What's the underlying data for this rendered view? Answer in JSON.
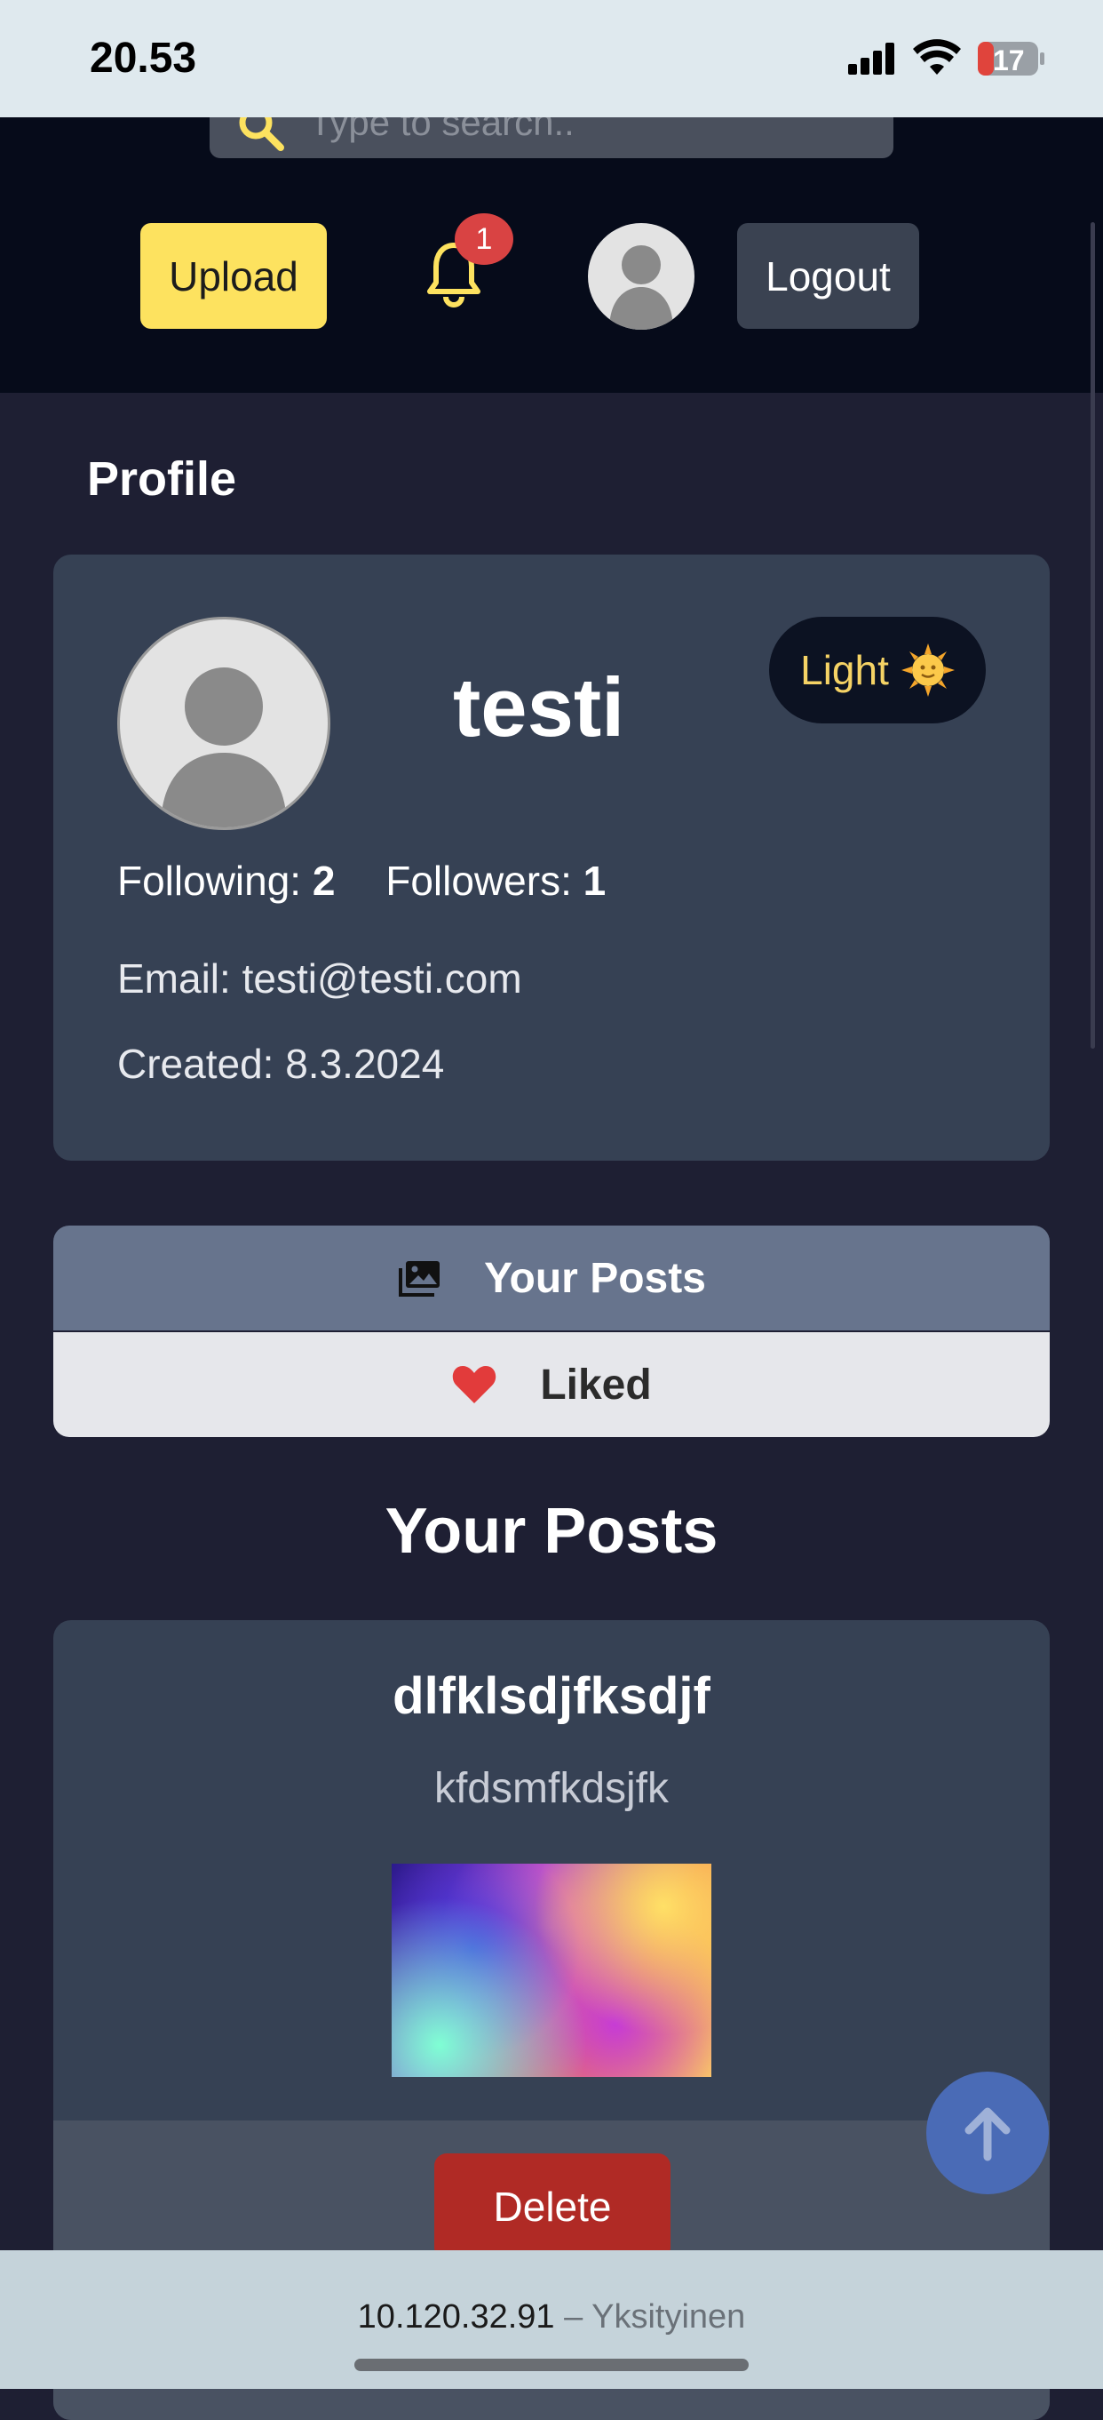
{
  "status_bar": {
    "time": "20.53",
    "battery_level": "17",
    "icons": [
      "signal-icon",
      "wifi-icon",
      "battery-icon"
    ]
  },
  "header": {
    "search_placeholder": "Type to search..",
    "upload_label": "Upload",
    "notification_count": "1",
    "logout_label": "Logout",
    "icons": [
      "search-icon",
      "bell-icon",
      "avatar-icon"
    ]
  },
  "profile": {
    "page_title": "Profile",
    "username": "testi",
    "theme_toggle_label": "Light",
    "theme_icon": "sun-icon",
    "following_label": "Following:",
    "following_count": "2",
    "followers_label": "Followers:",
    "followers_count": "1",
    "email_label": "Email:",
    "email_value": "testi@testi.com",
    "created_label": "Created:",
    "created_value": "8.3.2024"
  },
  "tabs": [
    {
      "label": "Your Posts",
      "icon": "photos-icon",
      "active": true
    },
    {
      "label": "Liked",
      "icon": "heart-icon",
      "active": false
    }
  ],
  "posts_section": {
    "title": "Your Posts",
    "posts": [
      {
        "title": "dlfklsdjfksdjf",
        "description": "kfdsmfkdsjfk",
        "delete_label": "Delete"
      }
    ]
  },
  "browser": {
    "address": "10.120.32.91",
    "separator": " – ",
    "mode": "Yksityinen"
  },
  "colors": {
    "accent_yellow": "#fde25f",
    "page_bg": "#1e1f33",
    "card_bg": "#364154",
    "delete_red": "#b02a25",
    "badge_red": "#d94343"
  }
}
